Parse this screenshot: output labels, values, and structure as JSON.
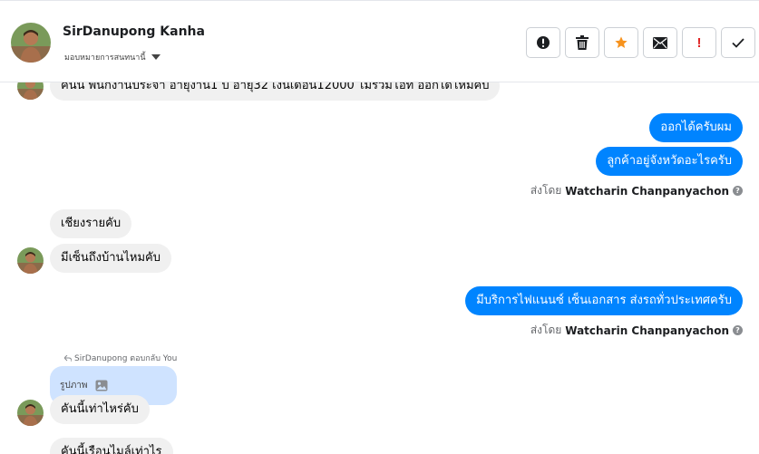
{
  "header": {
    "name": "SirDanupong Kanha",
    "assign_label": "มอบหมายการสนทนานี้"
  },
  "toolbar": {
    "buttons": [
      {
        "id": "report",
        "icon": "alert-circle-icon"
      },
      {
        "id": "delete",
        "icon": "trash-icon"
      },
      {
        "id": "star",
        "icon": "star-icon",
        "color": "#f7931e"
      },
      {
        "id": "mail",
        "icon": "envelope-icon"
      },
      {
        "id": "important",
        "icon": "exclamation-icon",
        "label": "!",
        "color": "#e02424"
      },
      {
        "id": "done",
        "icon": "check-icon"
      }
    ]
  },
  "messages": {
    "m1": "คันนี้ พนักงานประจำ อายุงาน1 ปี อายุ32 เงินเดือน12000 ไม่รวมโอที ออกได้ไหมคับ",
    "m2": "ออกได้ครับผม",
    "m3": "ลูกค้าอยู่จังหวัดอะไรครับ",
    "m4": "เชียงรายคับ",
    "m5": "มีเซ็นถึงบ้านไหมคับ",
    "m6": "มีบริการไฟแนนซ์ เซ็นเอกสาร ส่งรถทั่วประเทศครับ",
    "m7": "คันนี้เท่าไหร่คับ",
    "m8": "คันนี้เรือนไมล์เท่าไร"
  },
  "sent_by": {
    "prefix": "ส่งโดย",
    "agent": "Watcharin Chanpanyachon",
    "help": "?"
  },
  "reply": {
    "note": "SirDanupong ตอบกลับ You",
    "photo_label": "รูปภาพ"
  },
  "colors": {
    "outgoing": "#0084ff",
    "incoming": "#f0f0f0",
    "reply_card": "#cfe3ff"
  }
}
